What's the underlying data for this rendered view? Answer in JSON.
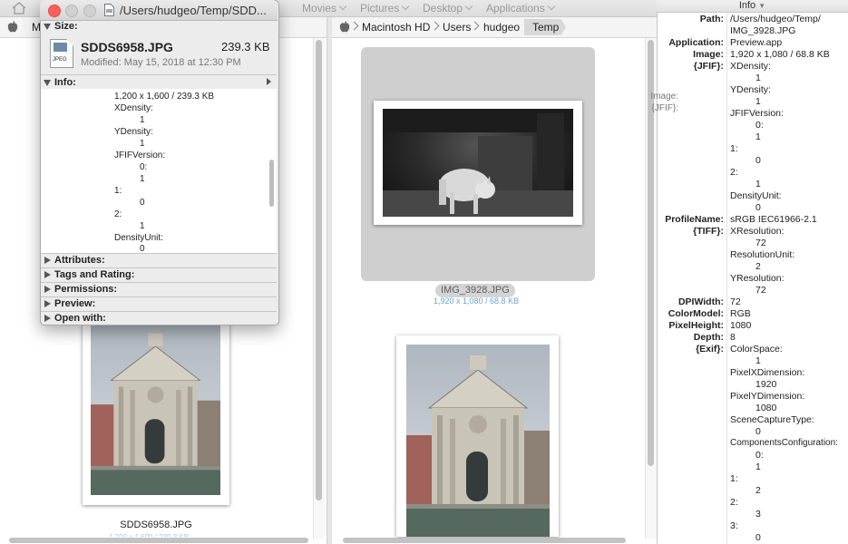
{
  "top_path": {
    "items": [
      "Movies",
      "Pictures",
      "Desktop",
      "Applications"
    ]
  },
  "left_column": {
    "breadcrumb_partial": "M",
    "file": {
      "name": "SDDS6958.JPG",
      "sub": "1,200 x 1,600 / 239.3 KB"
    }
  },
  "right_column": {
    "breadcrumb": [
      "Macintosh HD",
      "Users",
      "hudgeo",
      "Temp"
    ],
    "selected": {
      "name": "IMG_3928.JPG",
      "dims": "1,920 x 1,080 / 68.8 KB"
    }
  },
  "info_panel": {
    "title": "Info",
    "path_label": "Path:",
    "path_line1": "/Users/hudgeo/Temp/",
    "path_line2": "IMG_3928.JPG",
    "application_label": "Application:",
    "application": "Preview.app",
    "image_label": "Image:",
    "image": "1,920 x 1,080 / 68.8 KB",
    "jfif_label": "{JFIF}:",
    "jfif_xdensity_label": "XDensity:",
    "jfif_xdensity": "1",
    "jfif_ydensity_label": "YDensity:",
    "jfif_ydensity": "1",
    "jfif_version_label": "JFIFVersion:",
    "jfif_version_0_label": "0:",
    "jfif_version_0": "1",
    "jfif_version_1_label": "1:",
    "jfif_version_1": "0",
    "jfif_version_2_label": "2:",
    "jfif_version_2": "1",
    "jfif_densityunit_label": "DensityUnit:",
    "jfif_densityunit": "0",
    "profile_label": "ProfileName:",
    "profile": "sRGB IEC61966-2.1",
    "tiff_label": "{TIFF}:",
    "tiff_xres_label": "XResolution:",
    "tiff_xres": "72",
    "tiff_resunit_label": "ResolutionUnit:",
    "tiff_resunit": "2",
    "tiff_yres_label": "YResolution:",
    "tiff_yres": "72",
    "dpiwidth_label": "DPIWidth:",
    "dpiwidth": "72",
    "colormodel_label": "ColorModel:",
    "colormodel": "RGB",
    "pixelheight_label": "PixelHeight:",
    "pixelheight": "1080",
    "depth_label": "Depth:",
    "depth": "8",
    "exif_label": "{Exif}:",
    "exif_colorspace_label": "ColorSpace:",
    "exif_colorspace": "1",
    "exif_pxdim_label": "PixelXDimension:",
    "exif_pxdim": "1920",
    "exif_pydim_label": "PixelYDimension:",
    "exif_pydim": "1080",
    "exif_scene_label": "SceneCaptureType:",
    "exif_scene": "0",
    "exif_compconf_label": "ComponentsConfiguration:",
    "exif_cc_0_label": "0:",
    "exif_cc_0": "1",
    "exif_cc_1_label": "1:",
    "exif_cc_1": "2",
    "exif_cc_2_label": "2:",
    "exif_cc_2": "3",
    "exif_cc_3_label": "3:",
    "exif_cc_3": "0"
  },
  "get_info": {
    "title": "/Users/hudgeo/Temp/SDD...",
    "size_label": "Size:",
    "icon_text": "JPEG",
    "filename": "SDDS6958.JPG",
    "filesize": "239.3 KB",
    "modified": "Modified: May 15, 2018 at 12:30 PM",
    "info_label": "Info:",
    "image_label": "Image:",
    "image": "1,200 x 1,600 / 239.3 KB",
    "jfif_label": "{JFIF}:",
    "xdensity_label": "XDensity:",
    "xdensity": "1",
    "ydensity_label": "YDensity:",
    "ydensity": "1",
    "jfifversion_label": "JFIFVersion:",
    "v0_label": "0:",
    "v0": "1",
    "v1_label": "1:",
    "v1": "0",
    "v2_label": "2:",
    "v2": "1",
    "densityunit_label": "DensityUnit:",
    "densityunit": "0",
    "sections": [
      "Attributes:",
      "Tags and Rating:",
      "Permissions:",
      "Preview:",
      "Open with:"
    ]
  },
  "colors": {
    "close": "#fc605c",
    "minimize": "#d0d0d0",
    "zoom": "#d0d0d0",
    "selection_link": "#6aa3d8"
  },
  "icons": [
    "home-icon",
    "apple-icon",
    "document-icon",
    "disclosure-triangle-icon"
  ]
}
